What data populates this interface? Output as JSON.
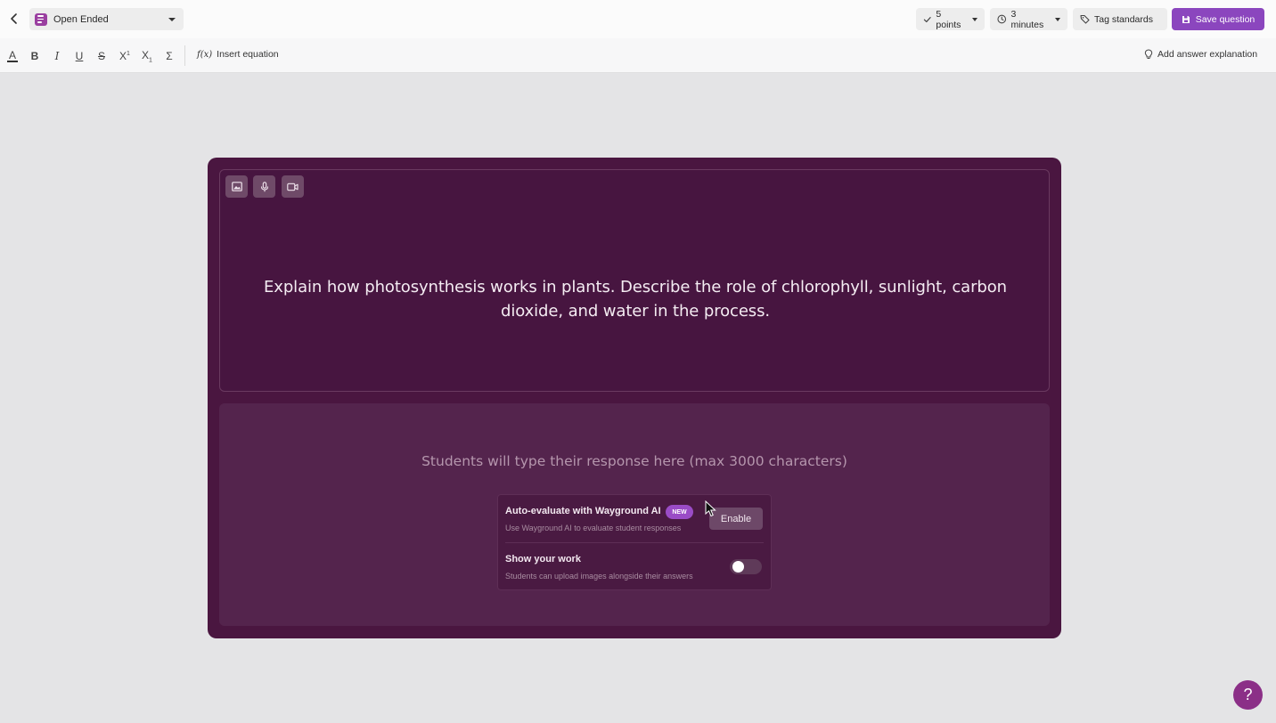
{
  "header": {
    "question_type": "Open Ended",
    "points": "5 points",
    "time": "3 minutes",
    "tag_standards": "Tag standards",
    "save": "Save question"
  },
  "toolbar": {
    "text_color": "A",
    "bold": "B",
    "italic": "I",
    "underline": "U",
    "strikethrough": "S",
    "superscript": "X",
    "superscript_mark": "1",
    "subscript": "X",
    "subscript_mark": "1",
    "sum": "Σ",
    "insert_equation": "Insert equation",
    "fx": "f(x)",
    "add_explanation": "Add answer explanation"
  },
  "question": {
    "text": "Explain how photosynthesis works in plants. Describe the role of chlorophyll, sunlight, carbon dioxide, and water in the process."
  },
  "answer": {
    "placeholder": "Students will type their response here (max 3000 characters)"
  },
  "options": {
    "auto_eval_title": "Auto-evaluate with Wayground AI",
    "auto_eval_badge": "NEW",
    "auto_eval_sub": "Use Wayground AI to evaluate student responses",
    "enable": "Enable",
    "show_work_title": "Show your work",
    "show_work_sub": "Students can upload images alongside their answers",
    "show_work_on": false
  },
  "help": "?",
  "colors": {
    "accent": "#8b46be",
    "card": "#4a1640",
    "help": "#8b2f87"
  }
}
